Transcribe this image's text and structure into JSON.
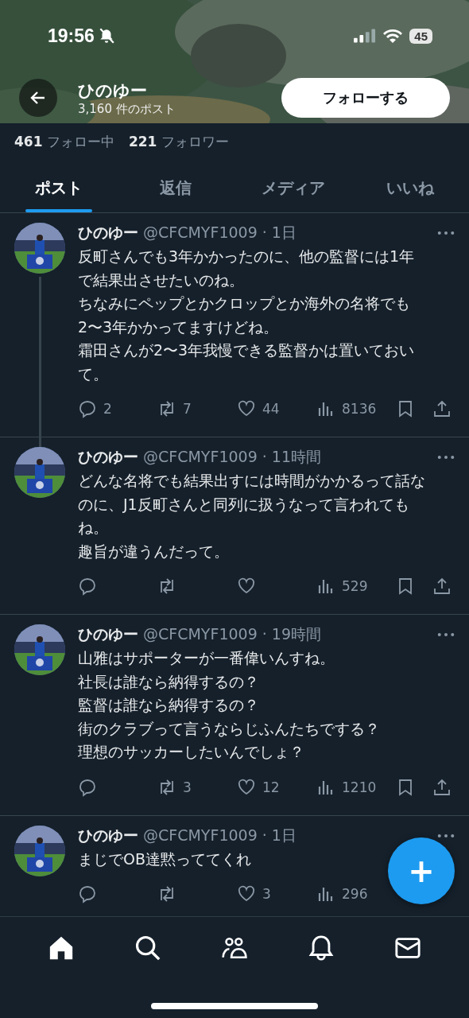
{
  "status_bar": {
    "time": "19:56",
    "silent": true,
    "battery": "45"
  },
  "header": {
    "name": "ひのゆー",
    "post_count": "3,160 件のポスト",
    "follow_button": "フォローする"
  },
  "stats": [
    {
      "count": "461",
      "label": "フォロー中"
    },
    {
      "count": "221",
      "label": "フォロワー"
    }
  ],
  "tabs": [
    {
      "label": "ポスト",
      "selected": true
    },
    {
      "label": "返信",
      "selected": false
    },
    {
      "label": "メディア",
      "selected": false
    },
    {
      "label": "いいね",
      "selected": false
    }
  ],
  "posts": [
    {
      "name": "ひのゆー",
      "handle": "@CFCMYF1009",
      "time": "· 1日",
      "lines": [
        "反町さんでも3年かかったのに、他の監督には1年で結果出させたいのね。",
        "ちなみにペップとかクロップとか海外の名将でも2〜3年かかってますけどね。",
        "霜田さんが2〜3年我慢できる監督かは置いておいて。"
      ],
      "thread": true,
      "actions": [
        {
          "kind": "reply",
          "count": "2"
        },
        {
          "kind": "repost",
          "count": "7"
        },
        {
          "kind": "like",
          "count": "44"
        },
        {
          "kind": "views",
          "count": "8136"
        },
        {
          "kind": "bookmark"
        },
        {
          "kind": "share"
        }
      ]
    },
    {
      "name": "ひのゆー",
      "handle": "@CFCMYF1009",
      "time": "· 11時間",
      "lines": [
        "どんな名将でも結果出すには時間がかかるって話なのに、J1反町さんと同列に扱うなって言われてもね。",
        "趣旨が違うんだって。"
      ],
      "actions": [
        {
          "kind": "reply"
        },
        {
          "kind": "repost"
        },
        {
          "kind": "like"
        },
        {
          "kind": "views",
          "count": "529"
        },
        {
          "kind": "bookmark"
        },
        {
          "kind": "share"
        }
      ]
    },
    {
      "name": "ひのゆー",
      "handle": "@CFCMYF1009",
      "time": "· 19時間",
      "lines": [
        "山雅はサポーターが一番偉いんすね。",
        "社長は誰なら納得するの？",
        "監督は誰なら納得するの？",
        "街のクラブって言うならじふんたちでする？",
        "理想のサッカーしたいんでしょ？"
      ],
      "actions": [
        {
          "kind": "reply"
        },
        {
          "kind": "repost",
          "count": "3"
        },
        {
          "kind": "like",
          "count": "12"
        },
        {
          "kind": "views",
          "count": "1210"
        },
        {
          "kind": "bookmark"
        },
        {
          "kind": "share"
        }
      ]
    },
    {
      "name": "ひのゆー",
      "handle": "@CFCMYF1009",
      "time": "· 1日",
      "lines": [
        "まじでOB達黙っててくれ"
      ],
      "actions": [
        {
          "kind": "reply"
        },
        {
          "kind": "repost"
        },
        {
          "kind": "like",
          "count": "3"
        },
        {
          "kind": "views",
          "count": "296"
        }
      ]
    }
  ],
  "compose_button": "+"
}
